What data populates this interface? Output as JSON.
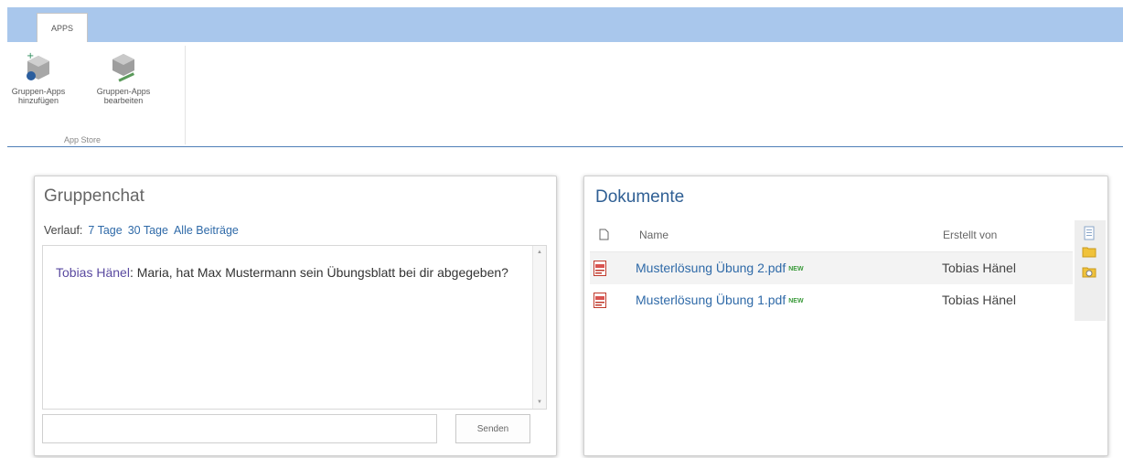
{
  "ribbon": {
    "tab_label": "APPS",
    "buttons": [
      {
        "label_line1": "Gruppen-Apps",
        "label_line2": "hinzufügen"
      },
      {
        "label_line1": "Gruppen-Apps",
        "label_line2": "bearbeiten"
      }
    ],
    "group_label": "App Store"
  },
  "chat": {
    "title": "Gruppenchat",
    "history_label": "Verlauf:",
    "history_links": [
      "7 Tage",
      "30 Tage",
      "Alle Beiträge"
    ],
    "message_author": "Tobias Hänel",
    "message_text": "Maria, hat Max Mustermann sein Übungsblatt bei dir abgegeben?",
    "input_value": "",
    "send_label": "Senden"
  },
  "documents": {
    "title": "Dokumente",
    "columns": {
      "name": "Name",
      "created_by": "Erstellt von"
    },
    "rows": [
      {
        "name": "Musterlösung Übung 2.pdf",
        "badge": "NEW",
        "created_by": "Tobias Hänel"
      },
      {
        "name": "Musterlösung Übung 1.pdf",
        "badge": "NEW",
        "created_by": "Tobias Hänel"
      }
    ]
  },
  "colors": {
    "ribbon": "#a9c7ec",
    "link": "#2f6aa8",
    "title_blue": "#2f5f94",
    "author": "#5a4aa0"
  }
}
